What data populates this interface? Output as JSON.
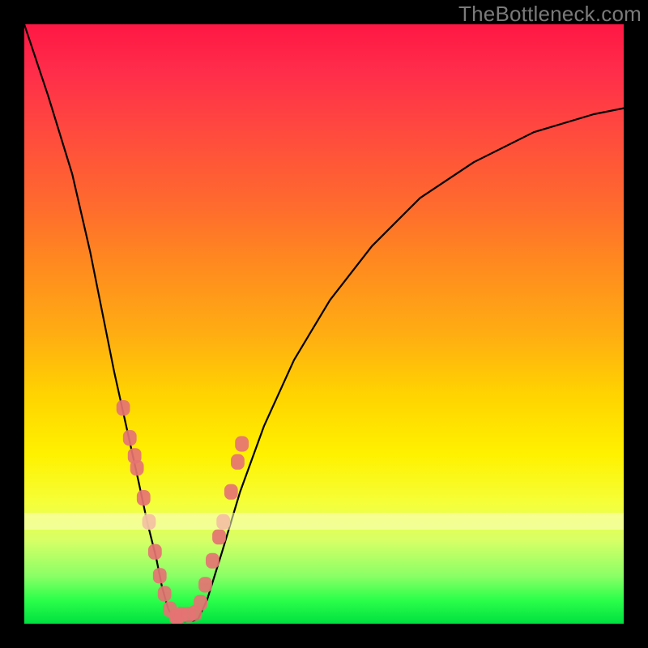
{
  "watermark": "TheBottleneck.com",
  "chart_data": {
    "type": "line",
    "title": "",
    "xlabel": "",
    "ylabel": "",
    "xlim": [
      0,
      100
    ],
    "ylim": [
      0,
      100
    ],
    "grid": false,
    "legend": false,
    "curve_left": {
      "x": [
        0,
        4,
        8,
        11,
        13,
        15,
        17,
        19,
        20.5,
        22,
        23,
        24,
        25
      ],
      "y": [
        100,
        88,
        75,
        62,
        52,
        42,
        33,
        24,
        17,
        11,
        6,
        2.5,
        0.5
      ]
    },
    "curve_flat": {
      "x": [
        25,
        26,
        27,
        28,
        29
      ],
      "y": [
        0.5,
        0.4,
        0.4,
        0.45,
        0.8
      ]
    },
    "curve_right": {
      "x": [
        29,
        30.5,
        33,
        36,
        40,
        45,
        51,
        58,
        66,
        75,
        85,
        95,
        100
      ],
      "y": [
        0.8,
        4,
        12,
        22,
        33,
        44,
        54,
        63,
        71,
        77,
        82,
        85,
        86
      ]
    },
    "markers_left": {
      "x": [
        16.5,
        17.6,
        18.4,
        18.8,
        19.9,
        20.8,
        21.8,
        22.6,
        23.4,
        24.3,
        25.3,
        25.5
      ],
      "y": [
        36,
        31,
        28,
        26,
        21,
        17,
        12,
        8,
        5,
        2.4,
        1.2,
        1.1
      ]
    },
    "markers_right": {
      "x": [
        26.2,
        27.4,
        28.5,
        29.4,
        30.2,
        31.4,
        32.5,
        33.2,
        34.5,
        35.6,
        36.3
      ],
      "y": [
        1.5,
        1.5,
        1.8,
        3.5,
        6.5,
        10.5,
        14.5,
        17,
        22,
        27,
        30
      ]
    }
  }
}
